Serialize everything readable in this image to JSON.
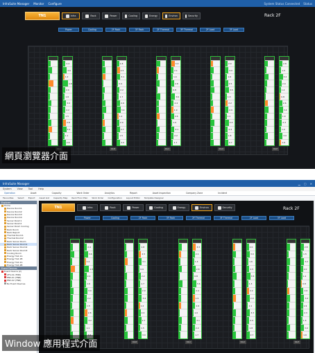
{
  "web": {
    "titlebar": {
      "app": "InfraSuite Manager",
      "m1": "Monitor",
      "m2": "Configure",
      "status": "System Status Connected",
      "r1": "Status"
    },
    "tn": "TN1",
    "buttons": [
      "Infra",
      "Rack",
      "Power",
      "Cooling",
      "Energy",
      "Environ",
      "Security"
    ],
    "rack_title": "Rack 2F",
    "subtabs": [
      "Power",
      "Cooling",
      "2F Rack",
      "3F Rack",
      "2F Thermal",
      "3F Thermal",
      "2F Load",
      "3F Load"
    ],
    "caption": "網頁瀏覽器介面"
  },
  "win": {
    "titlebar": {
      "app": "InfraSuite Manager"
    },
    "menu": [
      "System",
      "View",
      "Tool",
      "Help"
    ],
    "tabs": [
      "Operation",
      "Asset",
      "Capacity",
      "Work Order",
      "Analytics",
      "Report",
      "Asset Inspection",
      "Company Zone",
      "Incident"
    ],
    "tools": [
      "Favourites",
      "Select",
      "Export",
      "Asset List",
      "Capacity Map",
      "Rack Floor Plan",
      "Work Order",
      "Configuration",
      "Layout Editor",
      "Template Designer"
    ],
    "tree_header": "Explorer",
    "tree": [
      "Home",
      "Device Room1",
      "Device Room2",
      "Device Room3",
      "Device Room4",
      "Server Room1",
      "Server Room2",
      "Server Room Cooling",
      "Rack Room",
      "Rack Report",
      "Thermal Room1",
      "Thermal Room2",
      "Rack Server Room",
      "Rack Server Room1",
      "Rack Server Room2",
      "Rack Server Room3",
      "Cooling Room",
      "Energy Hub 1A",
      "Energy Hub 1B",
      "Energy Hub 2A",
      "Energy Hub 2B"
    ],
    "tree_header2": "Event Devices",
    "tree2": [
      "Event Device (2)",
      "ATS-01 (TNR)",
      "ENV-01 (TNR)",
      "ENV-02 (TNR)",
      "No Event Devices"
    ],
    "tn": "TN1",
    "buttons": [
      "Infra",
      "Rack",
      "Power",
      "Cooling",
      "Energy",
      "Environ",
      "Security"
    ],
    "rack_title": "Rack 2F",
    "subtabs": [
      "Power",
      "Cooling",
      "2F Rack",
      "3F Rack",
      "2F Thermal",
      "3F Thermal",
      "2F Load",
      "3F Load"
    ],
    "caption": "Window 應用程式介面"
  },
  "racks_top": [
    {
      "vals": [
        "2.4",
        "3.6",
        "1.2",
        "4.8",
        "2.0",
        "1.6",
        "3.0",
        "2.2",
        "1.5",
        "2.8",
        "3.2",
        "1.1",
        "2.6"
      ],
      "foot": "RK-A"
    },
    {
      "vals": [
        "1.8",
        "2.5",
        "3.1",
        "0.9",
        "2.2",
        "1.7",
        "2.9",
        "3.4",
        "1.2",
        "2.0",
        "2.7",
        "1.5",
        "3.0"
      ],
      "foot": "RK-B"
    },
    {
      "vals": [
        "3.3",
        "2.1",
        "1.4",
        "2.8",
        "0.8",
        "3.6",
        "2.4",
        "1.9",
        "2.6",
        "1.0",
        "3.1",
        "2.2",
        "1.7"
      ],
      "foot": "RK-C"
    },
    {
      "vals": [
        "2.0",
        "3.0",
        "1.6",
        "2.5",
        "3.5",
        "1.3",
        "2.2",
        "2.9",
        "1.1",
        "3.3",
        "2.4",
        "1.8",
        "2.7"
      ],
      "foot": "RK-D"
    },
    {
      "vals": [
        "2.8",
        "1.5",
        "3.2",
        "2.0",
        "1.2",
        "0.8",
        "2.6",
        "3.4",
        "1.9",
        "2.3",
        "1.4",
        "3.0",
        "1.6"
      ],
      "foot": "RK-E"
    }
  ]
}
